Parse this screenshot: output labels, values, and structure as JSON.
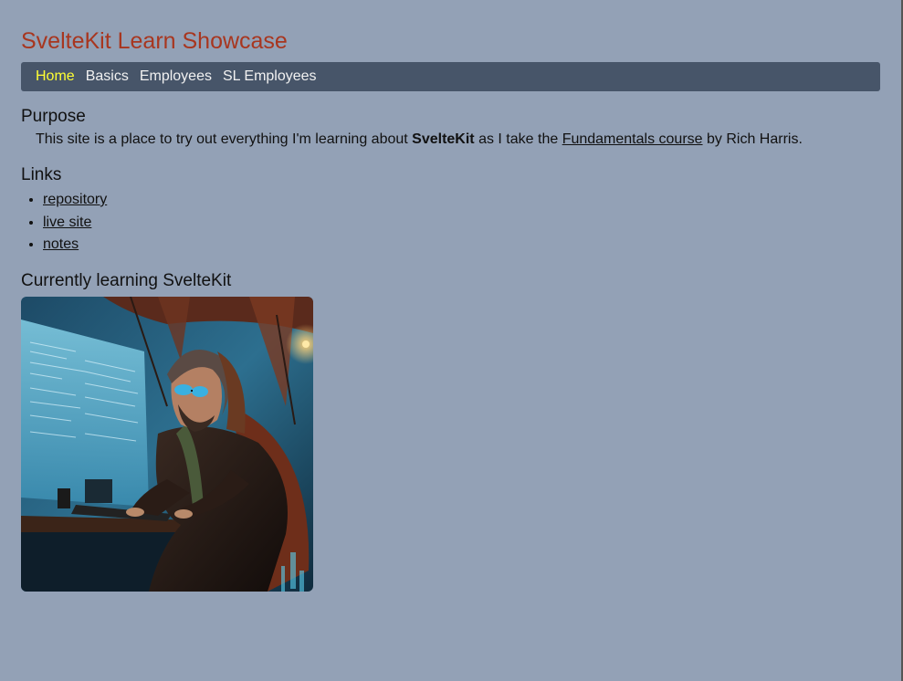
{
  "site": {
    "title": "SvelteKit Learn Showcase"
  },
  "nav": {
    "items": [
      {
        "label": "Home",
        "active": true
      },
      {
        "label": "Basics",
        "active": false
      },
      {
        "label": "Employees",
        "active": false
      },
      {
        "label": "SL Employees",
        "active": false
      }
    ],
    "active_color": "#ffff33"
  },
  "purpose": {
    "heading": "Purpose",
    "text_before": "This site is a place to try out everything I'm learning about ",
    "bold": "SvelteKit",
    "text_middle": " as I take the ",
    "link": "Fundamentals course",
    "text_after": " by Rich Harris."
  },
  "links": {
    "heading": "Links",
    "items": [
      "repository",
      "live site",
      "notes"
    ]
  },
  "learning": {
    "heading": "Currently learning SvelteKit",
    "image_subject": "hooded-coder-illustration"
  },
  "colors": {
    "background": "#93a1b6",
    "title": "#a8361f",
    "navbar": "#475569"
  }
}
